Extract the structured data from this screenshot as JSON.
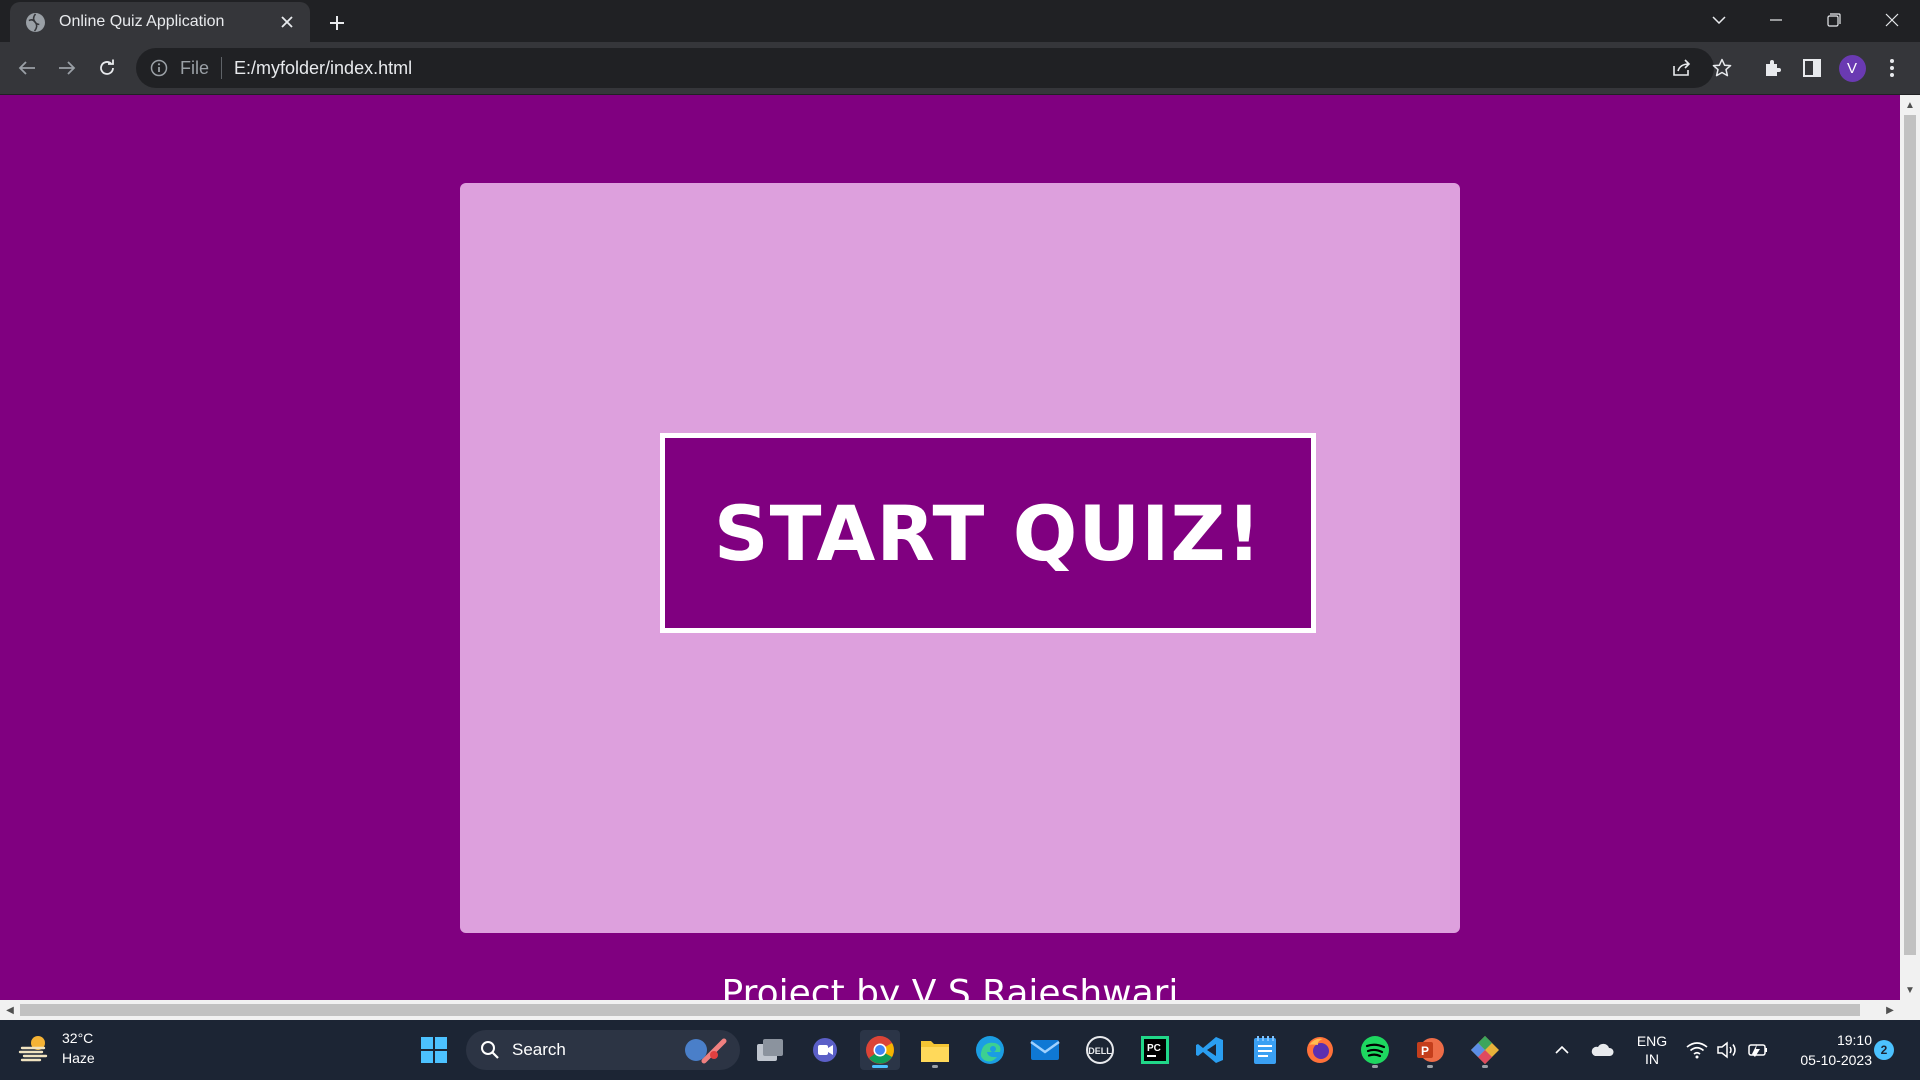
{
  "browser": {
    "tab_title": "Online Quiz Application",
    "address_scheme": "File",
    "address_url": "E:/myfolder/index.html",
    "profile_initial": "V"
  },
  "page": {
    "start_button_label": "START QUIZ!",
    "credit_text": "Project by V S Rajeshwari",
    "colors": {
      "page_bg": "#800080",
      "card_bg": "#dda0dd",
      "button_bg": "#800080",
      "button_border": "#ffffff"
    }
  },
  "taskbar": {
    "weather_temp": "32°C",
    "weather_desc": "Haze",
    "search_label": "Search",
    "lang_line1": "ENG",
    "lang_line2": "IN",
    "time": "19:10",
    "date": "05-10-2023",
    "notification_count": "2"
  }
}
